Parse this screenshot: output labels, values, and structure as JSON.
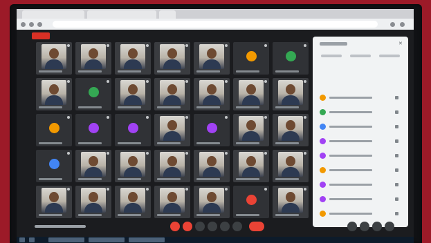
{
  "colors": {
    "background_wall": "#9c1a28",
    "meeting_bg": "#1b1c1f",
    "tile_bg": "#303236",
    "panel_bg": "#f1f3f4",
    "record_red": "#d93025"
  },
  "tiles": [
    {
      "kind": "video"
    },
    {
      "kind": "video"
    },
    {
      "kind": "video"
    },
    {
      "kind": "video"
    },
    {
      "kind": "video"
    },
    {
      "kind": "avatar",
      "color": "#f29900"
    },
    {
      "kind": "avatar",
      "color": "#34a853"
    },
    {
      "kind": "video"
    },
    {
      "kind": "avatar",
      "color": "#34a853"
    },
    {
      "kind": "video"
    },
    {
      "kind": "video"
    },
    {
      "kind": "video"
    },
    {
      "kind": "video"
    },
    {
      "kind": "video"
    },
    {
      "kind": "avatar",
      "color": "#f29900"
    },
    {
      "kind": "avatar",
      "color": "#a142f4"
    },
    {
      "kind": "avatar",
      "color": "#a142f4"
    },
    {
      "kind": "video"
    },
    {
      "kind": "avatar",
      "color": "#a142f4"
    },
    {
      "kind": "video"
    },
    {
      "kind": "video"
    },
    {
      "kind": "avatar",
      "color": "#4285f4"
    },
    {
      "kind": "video"
    },
    {
      "kind": "video"
    },
    {
      "kind": "video"
    },
    {
      "kind": "video"
    },
    {
      "kind": "video"
    },
    {
      "kind": "video"
    },
    {
      "kind": "video"
    },
    {
      "kind": "video"
    },
    {
      "kind": "video"
    },
    {
      "kind": "video"
    },
    {
      "kind": "video"
    },
    {
      "kind": "avatar",
      "color": "#ea4335"
    },
    {
      "kind": "video"
    }
  ],
  "participants_panel": {
    "avatar_colors": [
      "#f29900",
      "#34a853",
      "#4285f4",
      "#a142f4",
      "#a142f4",
      "#f29900",
      "#a142f4",
      "#a142f4",
      "#f29900"
    ]
  },
  "controls": {
    "icons": [
      "mic-off-icon",
      "camera-off-icon",
      "captions-icon",
      "present-icon",
      "more-icon",
      "hangup-icon"
    ]
  }
}
